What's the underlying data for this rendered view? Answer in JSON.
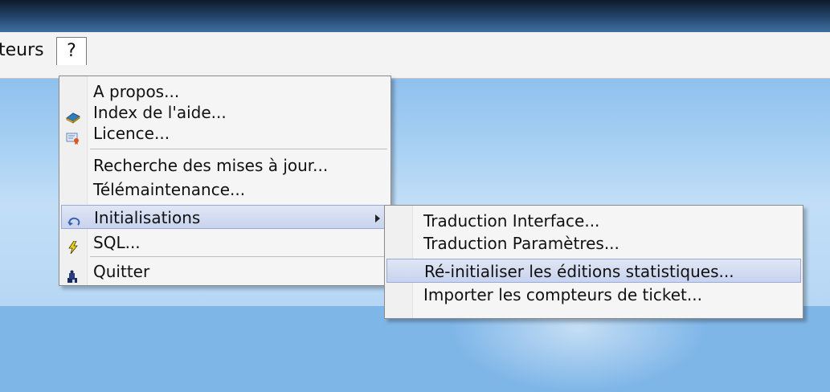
{
  "menubar": {
    "prev_label": "teurs",
    "help_label": "?"
  },
  "help_menu": {
    "items": [
      {
        "label": "A propos...",
        "icon": ""
      },
      {
        "label": "Index de l'aide...",
        "icon": "help-book-icon"
      },
      {
        "label": "Licence...",
        "icon": "certificate-icon"
      },
      {
        "label": "Recherche des mises à jour...",
        "icon": ""
      },
      {
        "label": "Télémaintenance...",
        "icon": ""
      },
      {
        "label": "Initialisations",
        "icon": "undo-arrow-icon"
      },
      {
        "label": "SQL...",
        "icon": "lightning-icon"
      },
      {
        "label": "Quitter",
        "icon": "exit-door-icon"
      }
    ]
  },
  "submenu": {
    "items": [
      {
        "label": "Traduction Interface..."
      },
      {
        "label": "Traduction Paramètres..."
      },
      {
        "label": "Ré-initialiser les éditions statistiques..."
      },
      {
        "label": "Importer les compteurs de ticket..."
      }
    ]
  },
  "colors": {
    "highlight": "#c8d3ee",
    "desktop": "#a7d0f3",
    "titlebar": "#1f3f63"
  }
}
